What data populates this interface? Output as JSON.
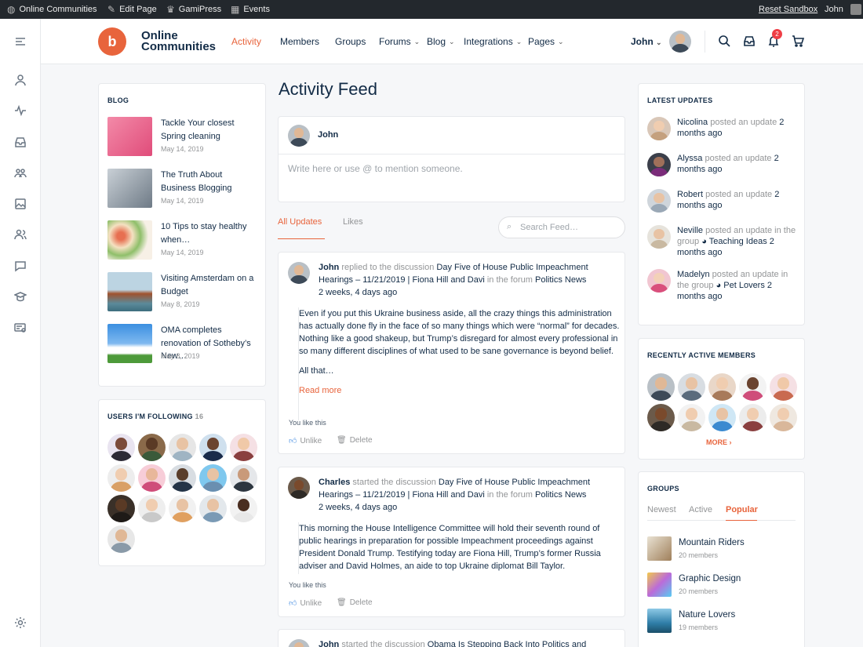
{
  "adminbar": {
    "site": "Online Communities",
    "edit_page": "Edit Page",
    "gamipress": "GamiPress",
    "events": "Events",
    "reset": "Reset Sandbox",
    "user": "John"
  },
  "sidebar": {
    "icons": [
      "menu-icon",
      "profile-icon",
      "activity-icon",
      "inbox-icon",
      "groups-icon",
      "photos-icon",
      "members-icon",
      "forums-icon",
      "courses-icon",
      "certificates-icon",
      "settings-icon"
    ]
  },
  "header": {
    "logo_line1": "Online",
    "logo_line2": "Communities",
    "logo_mark": "b",
    "nav": [
      {
        "label": "Activity",
        "dropdown": false
      },
      {
        "label": "Members",
        "dropdown": false
      },
      {
        "label": "Groups",
        "dropdown": false
      },
      {
        "label": "Forums",
        "dropdown": true
      },
      {
        "label": "Blog",
        "dropdown": true
      },
      {
        "label": "Integrations",
        "dropdown": true
      },
      {
        "label": "Pages",
        "dropdown": true
      }
    ],
    "user": "John",
    "notifications_count": "2"
  },
  "blog": {
    "title": "BLOG",
    "items": [
      {
        "title": "Tackle Your closest Spring cleaning",
        "date": "May 14, 2019",
        "color": "#f06a8f"
      },
      {
        "title": "The Truth About Business Blogging",
        "date": "May 14, 2019",
        "color": "#9aa4ad"
      },
      {
        "title": "10 Tips to stay healthy when…",
        "date": "May 14, 2019",
        "color": "#e9d8b8"
      },
      {
        "title": "Visiting Amsterdam on a Budget",
        "date": "May 8, 2019",
        "color": "#7fa6b5"
      },
      {
        "title": "OMA completes renovation of Sotheby’s New…",
        "date": "May 8, 2019",
        "color": "#4a8fd6"
      }
    ]
  },
  "following": {
    "title": "USERS I'M FOLLOWING",
    "count": "16"
  },
  "feed": {
    "title": "Activity Feed",
    "composer_user": "John",
    "composer_placeholder": "Write here or use @ to mention someone.",
    "tab_all": "All Updates",
    "tab_likes": "Likes",
    "search_placeholder": "Search Feed…",
    "posts": [
      {
        "author": "John",
        "action": "replied to the discussion",
        "topic": "Day Five of House Public Impeachment Hearings – 11/21/2019 | Fiona Hill and Davi",
        "in_forum": "in the forum",
        "forum": "Politics News",
        "time": "2 weeks, 4 days ago",
        "body1": "Even if you put this Ukraine business aside, all the crazy things this administration has actually done fly in the face of so many things which were “normal” for decades. Nothing like a good shakeup, but Trump’s disregard for almost every professional in so many different disciplines of what used to be sane governance is beyond belief.",
        "body2": "All that…",
        "read_more": "Read more",
        "like_line": "You like this",
        "unlike": "Unlike",
        "delete": "Delete"
      },
      {
        "author": "Charles",
        "action": "started the discussion",
        "topic": "Day Five of House Public Impeachment Hearings – 11/21/2019 | Fiona Hill and Davi",
        "in_forum": "in the forum",
        "forum": "Politics News",
        "time": "2 weeks, 4 days ago",
        "body1": "This morning the House Intelligence Committee will hold their seventh round of public hearings in preparation for possible Impeachment proceedings against President Donald Trump. Testifying today are Fiona Hill, Trump’s former Russia adviser and David Holmes, an aide to top Ukraine diplomat Bill Taylor.",
        "like_line": "You like this",
        "unlike": "Unlike",
        "delete": "Delete"
      },
      {
        "author": "John",
        "action": "started the discussion",
        "topic": "Obama Is Stepping Back Into Politics and"
      }
    ]
  },
  "latest": {
    "title": "LATEST UPDATES",
    "items": [
      {
        "name": "Nicolina",
        "text": "posted an update",
        "time": "2 months ago"
      },
      {
        "name": "Alyssa",
        "text": "posted an update",
        "time": "2 months ago"
      },
      {
        "name": "Robert",
        "text": "posted an update",
        "time": "2 months ago"
      },
      {
        "name": "Neville",
        "text": "posted an update in the group",
        "group": "Teaching Ideas",
        "time": "2 months ago"
      },
      {
        "name": "Madelyn",
        "text": "posted an update in the group",
        "group": "Pet Lovers",
        "time": "2 months ago"
      }
    ]
  },
  "recent": {
    "title": "RECENTLY ACTIVE MEMBERS",
    "more": "MORE"
  },
  "groups": {
    "title": "GROUPS",
    "tabs": [
      "Newest",
      "Active",
      "Popular"
    ],
    "items": [
      {
        "name": "Mountain Riders",
        "members": "20 members",
        "color": "#c9b79a"
      },
      {
        "name": "Graphic Design",
        "members": "20 members",
        "color": "#f2c94c"
      },
      {
        "name": "Nature Lovers",
        "members": "19 members",
        "color": "#4fa3c7"
      }
    ]
  },
  "colors": {
    "accent": "#e8643c",
    "text": "#122b46",
    "muted": "#939597"
  }
}
